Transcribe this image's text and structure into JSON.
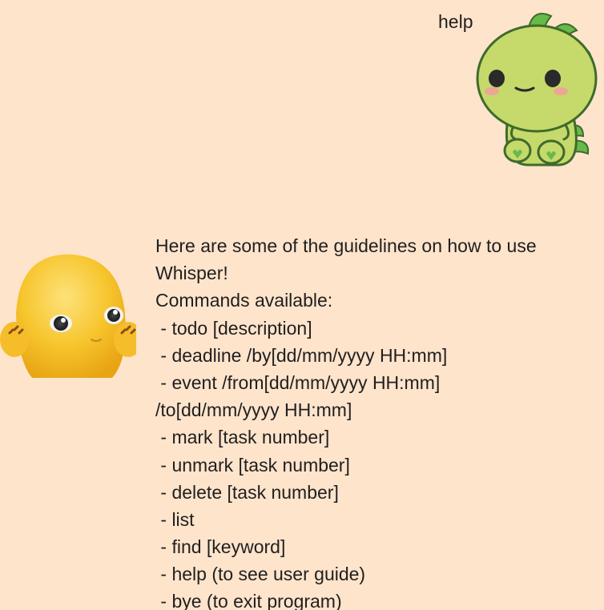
{
  "colors": {
    "background": "#FFE4CC",
    "text": "#1f1f1f",
    "dino_green": "#C6D96B",
    "dino_spikes": "#67BA49",
    "chick_yellow": "#F7C62F"
  },
  "user_message": {
    "text": "help",
    "avatar_icon": "green-dinosaur-avatar"
  },
  "bot_message": {
    "avatar_icon": "yellow-creature-avatar",
    "lines": [
      "Here are some of the guidelines on how to use",
      "Whisper!",
      "Commands available:",
      " - todo [description]",
      " - deadline /by[dd/mm/yyyy HH:mm]",
      " - event /from[dd/mm/yyyy HH:mm]",
      "/to[dd/mm/yyyy HH:mm]",
      " - mark [task number]",
      " - unmark [task number]",
      " - delete [task number]",
      " - list",
      " - find [keyword]",
      " - help (to see user guide)",
      " - bye (to exit program)"
    ]
  }
}
